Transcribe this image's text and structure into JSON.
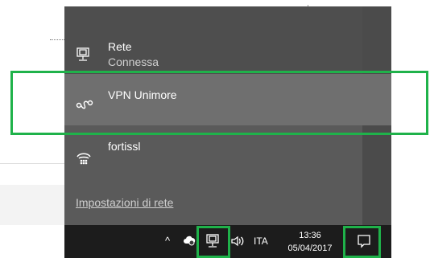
{
  "flyout": {
    "networks": [
      {
        "name": "Rete",
        "status": "Connessa",
        "icon": "ethernet-icon"
      },
      {
        "name": "VPN Unimore",
        "status": "",
        "icon": "vpn-icon"
      },
      {
        "name": "fortissl",
        "status": "",
        "icon": "dialup-icon"
      }
    ],
    "settings_link": "Impostazioni di rete"
  },
  "taskbar": {
    "chevron": "^",
    "language": "ITA",
    "time": "13:36",
    "date": "05/04/2017",
    "icons": [
      "show-hidden-icons-icon",
      "cloud-sync-icon",
      "network-icon",
      "volume-icon",
      "action-center-icon"
    ]
  },
  "colors": {
    "flyout_bg": "#5a5a5a",
    "selected_item": "#6f6f6f",
    "taskbar_bg": "#1c1c1c",
    "highlight": "#1fb24a"
  }
}
